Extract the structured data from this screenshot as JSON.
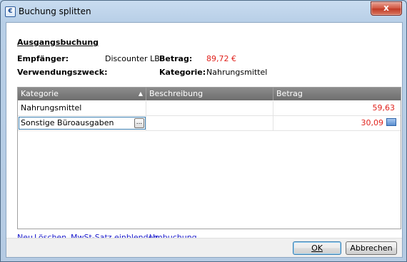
{
  "window": {
    "title": "Buchung splitten",
    "icon": "euro-icon",
    "icon_glyph": "€",
    "close_glyph": "x"
  },
  "source": {
    "section_title": "Ausgangsbuchung",
    "recipient_label": "Empfänger:",
    "recipient_value": "Discounter LB",
    "amount_label": "Betrag:",
    "amount_value": "89,72 €",
    "purpose_label": "Verwendungszweck:",
    "purpose_value": "",
    "category_label": "Kategorie:",
    "category_value": "Nahrungsmittel"
  },
  "grid": {
    "columns": [
      "Kategorie",
      "Beschreibung",
      "Betrag"
    ],
    "sort_column": "Kategorie",
    "sort_glyph": "▲",
    "rows": [
      {
        "category": "Nahrungsmittel",
        "description": "",
        "amount": "59,63"
      },
      {
        "category": "Sonstige Büroausgaben",
        "description": "",
        "amount": "30,09"
      }
    ],
    "ellipsis": "..."
  },
  "actions": {
    "new": "Neu",
    "delete": "Löschen",
    "vat_toggle": "MwSt-Satz einblenden",
    "rebook": "Umbuchung"
  },
  "buttons": {
    "ok": "OK",
    "cancel": "Abbrechen"
  },
  "colors": {
    "amount_red": "#e0221c",
    "link_blue": "#1a1acc",
    "header_gray": "#7d7d7d"
  }
}
